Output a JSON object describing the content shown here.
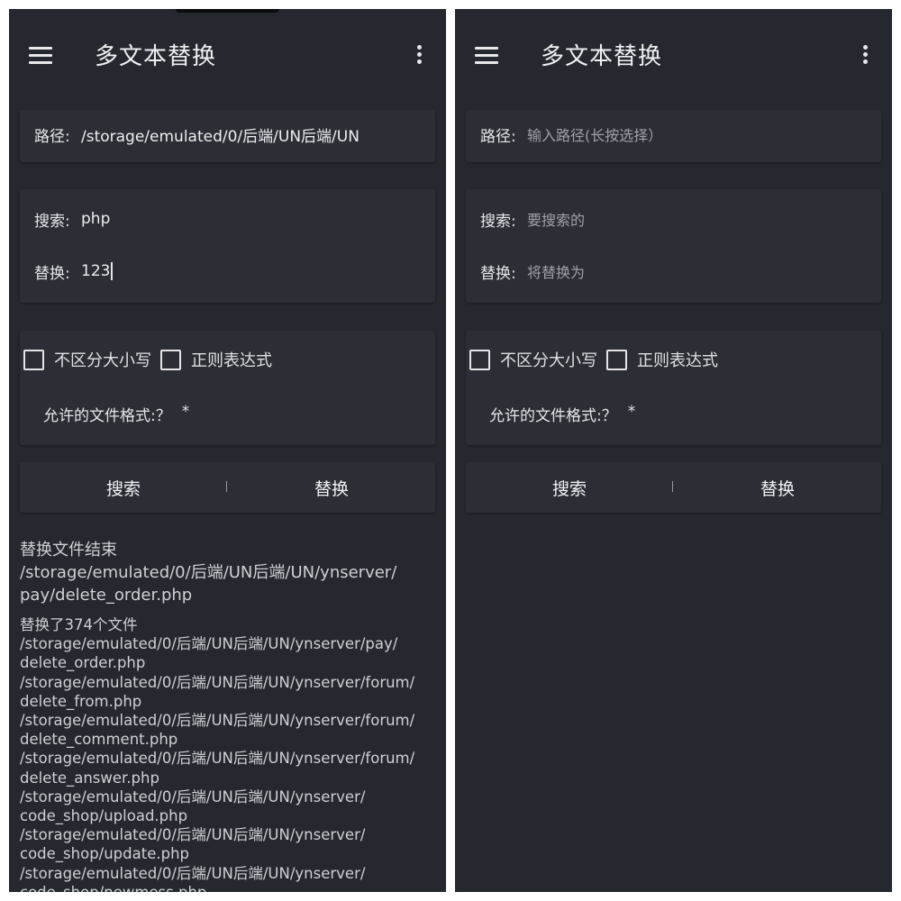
{
  "left": {
    "title": "多文本替换",
    "path_label": "路径:",
    "path_value": "/storage/emulated/0/后端/UN后端/UN",
    "search_label": "搜索:",
    "search_value": "php",
    "replace_label": "替换:",
    "replace_value": "123",
    "case_label": "不区分大小写",
    "regex_label": "正则表达式",
    "format_label": "允许的文件格式:？",
    "format_value": "*",
    "search_button": "搜索",
    "replace_button": "替换",
    "log_header_lines": [
      "替换文件结束",
      "/storage/emulated/0/后端/UN后端/UN/ynserver/",
      "pay/delete_order.php"
    ],
    "log_lines": [
      "替换了374个文件",
      "/storage/emulated/0/后端/UN后端/UN/ynserver/pay/",
      "delete_order.php",
      "/storage/emulated/0/后端/UN后端/UN/ynserver/forum/",
      "delete_from.php",
      "/storage/emulated/0/后端/UN后端/UN/ynserver/forum/",
      "delete_comment.php",
      "/storage/emulated/0/后端/UN后端/UN/ynserver/forum/",
      "delete_answer.php",
      "/storage/emulated/0/后端/UN后端/UN/ynserver/",
      "code_shop/upload.php",
      "/storage/emulated/0/后端/UN后端/UN/ynserver/",
      "code_shop/update.php",
      "/storage/emulated/0/后端/UN后端/UN/ynserver/",
      "code_shop/newmess.php"
    ]
  },
  "right": {
    "title": "多文本替换",
    "path_label": "路径:",
    "path_placeholder": "输入路径(长按选择）",
    "search_label": "搜索:",
    "search_placeholder": "要搜索的",
    "replace_label": "替换:",
    "replace_placeholder": "将替换为",
    "case_label": "不区分大小写",
    "regex_label": "正则表达式",
    "format_label": "允许的文件格式:？",
    "format_value": "*",
    "search_button": "搜索",
    "replace_button": "替换"
  },
  "colors": {
    "background": "#25282f",
    "card": "#2b2e35",
    "text": "#e6e6e8",
    "placeholder": "#9ea1a8"
  }
}
